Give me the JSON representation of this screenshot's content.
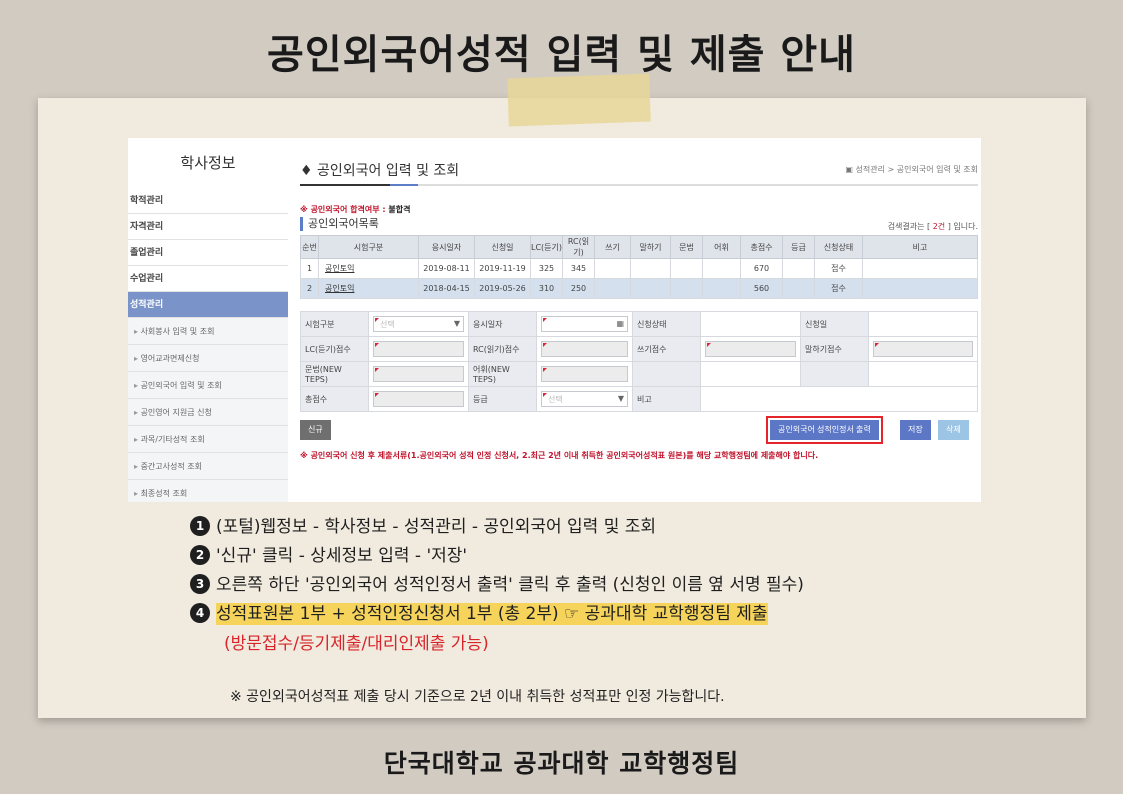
{
  "poster": {
    "title": "공인외국어성적 입력 및 제출 안내",
    "footer": "단국대학교 공과대학 교학행정팀"
  },
  "sidebar": {
    "title": "학사정보",
    "items": [
      {
        "label": "학적관리"
      },
      {
        "label": "자격관리"
      },
      {
        "label": "졸업관리"
      },
      {
        "label": "수업관리"
      },
      {
        "label": "성적관리",
        "active": true
      }
    ],
    "subitems": [
      {
        "label": "사회봉사 입력 및 조회"
      },
      {
        "label": "영어교과면제신청"
      },
      {
        "label": "공인외국어 입력 및 조회"
      },
      {
        "label": "공인영어 지원금 신청"
      },
      {
        "label": "과목/기타성적 조회"
      },
      {
        "label": "중간고사성적 조회"
      },
      {
        "label": "최종성적 조회"
      }
    ]
  },
  "main": {
    "title": "공인외국어 입력 및 조회",
    "breadcrumb": "성적관리 > 공인외국어 입력 및 조회",
    "notice_label": "※ 공인외국어 합격여부 : ",
    "notice_value": "불합격",
    "list_title": "공인외국어목록",
    "result_prefix": "검색결과는 [ ",
    "result_count": "2건",
    "result_suffix": " ] 입니다.",
    "columns": [
      "순번",
      "시험구분",
      "응시일자",
      "신청일",
      "LC(듣기)",
      "RC(읽기)",
      "쓰기",
      "말하기",
      "문법",
      "어휘",
      "총점수",
      "등급",
      "신청상태",
      "비고"
    ],
    "rows": [
      {
        "no": "1",
        "type": "공인토익",
        "exam_date": "2019-08-11",
        "apply_date": "2019-11-19",
        "lc": "325",
        "rc": "345",
        "total": "670",
        "status": "접수"
      },
      {
        "no": "2",
        "type": "공인토익",
        "exam_date": "2018-04-15",
        "apply_date": "2019-05-26",
        "lc": "310",
        "rc": "250",
        "total": "560",
        "status": "접수"
      }
    ],
    "form": {
      "exam_type": "시험구분",
      "exam_type_ph": "선택",
      "exam_date": "응시일자",
      "status": "신청상태",
      "apply_date": "신청일",
      "lc_score": "LC(듣기)점수",
      "rc_score": "RC(읽기)점수",
      "writing": "쓰기점수",
      "speaking": "말하기점수",
      "grammar": "문법(NEW TEPS)",
      "vocab": "어휘(NEW TEPS)",
      "total": "총점수",
      "grade": "등급",
      "grade_ph": "선택",
      "remark": "비고"
    },
    "buttons": {
      "new": "신규",
      "print": "공인외국어 성적인정서 출력",
      "save": "저장",
      "delete": "삭제"
    },
    "warning": "※ 공인외국어 신청 후 제출서류(1.공인외국어 성적 인정 신청서, 2.최근 2년 이내 취득한 공인외국어성적표 원본)를 해당 교학행정팀에 제출해야 합니다."
  },
  "steps": [
    {
      "num": "1",
      "text": "(포털)웹정보 - 학사정보 - 성적관리 - 공인외국어 입력 및 조회"
    },
    {
      "num": "2",
      "text": "'신규' 클릭 - 상세정보 입력 - '저장'"
    },
    {
      "num": "3",
      "text": "오른쪽 하단 '공인외국어 성적인정서 출력' 클릭 후 출력 (신청인 이름 옆 서명 필수)"
    },
    {
      "num": "4",
      "text": "성적표원본 1부 + 성적인정신청서 1부 (총 2부) ☞ 공과대학 교학행정팀 제출"
    }
  ],
  "step4_sub": "(방문접수/등기제출/대리인제출 가능)",
  "note": "※ 공인외국어성적표 제출 당시 기준으로 2년 이내 취득한 성적표만 인정 가능합니다.",
  "colors": {
    "accent": "#5d77c7",
    "warning": "#c0142c",
    "highlight": "#f6d35b"
  }
}
